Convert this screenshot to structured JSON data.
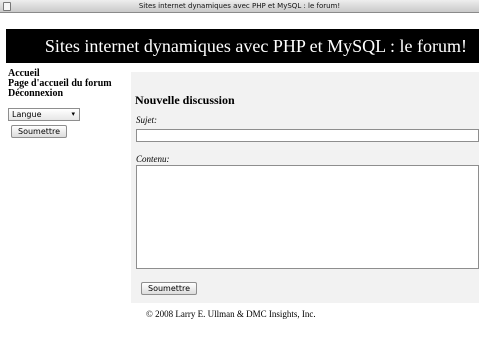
{
  "window": {
    "title": "Sites internet dynamiques avec PHP et MySQL : le forum!"
  },
  "banner": {
    "text": "Sites internet dynamiques avec PHP et MySQL : le forum!"
  },
  "sidebar": {
    "nav": [
      {
        "label": "Accueil"
      },
      {
        "label": "Page d'accueil du forum"
      },
      {
        "label": "Déconnexion"
      }
    ],
    "language_select": {
      "value": "Langue"
    },
    "submit_label": "Soumettre"
  },
  "form": {
    "heading": "Nouvelle discussion",
    "subject_label": "Sujet:",
    "subject_value": "",
    "content_label": "Contenu:",
    "content_value": "",
    "submit_label": "Soumettre"
  },
  "footer": {
    "text": "© 2008 Larry E. Ullman & DMC Insights, Inc."
  }
}
